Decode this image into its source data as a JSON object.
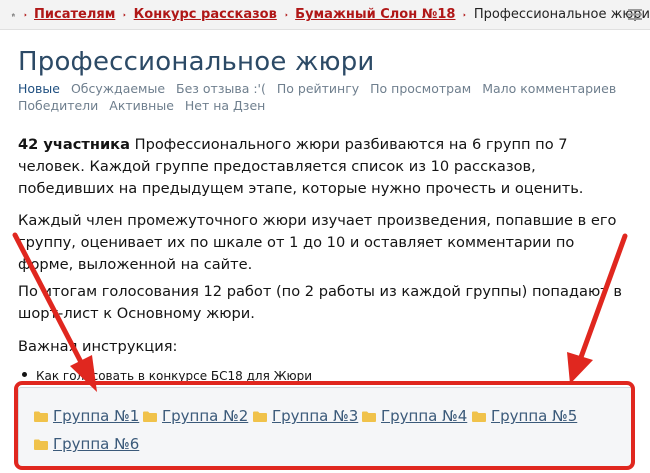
{
  "breadcrumb": {
    "items": [
      "Писателям",
      "Конкурс рассказов",
      "Бумажный Слон №18"
    ],
    "current": "Профессиональное жюри"
  },
  "title": "Профессиональное жюри",
  "tabs_row1": [
    "Новые",
    "Обсуждаемые",
    "Без отзыва :'(",
    "По рейтингу",
    "По просмотрам",
    "Мало комментариев"
  ],
  "tabs_row2": [
    "Победители",
    "Активные",
    "Нет на Дзен"
  ],
  "intro": {
    "count": "42 участника",
    "text": " Профессионального жюри разбиваются на 6 групп по 7 человек. Каждой группе предоставляется список из 10 рассказов, победивших на предыдущем этапе, которые нужно прочесть и оценить."
  },
  "paragraph2": "Каждый член промежуточного жюри изучает произведения, попавшие в его группу, оценивает их по шкале от 1 до 10 и оставляет комментарии по форме, выложенной на сайте.",
  "paragraph3": "По итогам голосования 12 работ (по 2 работы из каждой группы) попадают в шорт-лист к Основному жюри.",
  "instruction_label": "Важная инструкция:",
  "instruction_item": "Как голосовать в конкурсе БС18 для Жюри",
  "groups": [
    "Группа №1",
    "Группа №2",
    "Группа №3",
    "Группа №4",
    "Группа №5",
    "Группа №6"
  ],
  "colors": {
    "annotation": "#e0271f",
    "link_dark_red": "#b01717",
    "title_blue": "#2c4a66",
    "folder": "#f0c24b"
  }
}
